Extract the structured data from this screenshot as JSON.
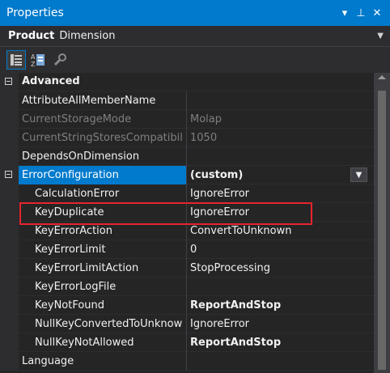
{
  "window": {
    "title": "Properties",
    "buttons": [
      "▾",
      "⊥",
      "✕"
    ]
  },
  "object": {
    "name": "Product",
    "type": "Dimension"
  },
  "toolbar": {
    "tools": [
      "categorized-icon",
      "alphabetical-icon",
      "property-pages-icon"
    ]
  },
  "grid": {
    "category": "Advanced",
    "rows": [
      {
        "name": "AttributeAllMemberName",
        "value": "",
        "style": "normal"
      },
      {
        "name": "CurrentStorageMode",
        "value": "Molap",
        "style": "gray"
      },
      {
        "name": "CurrentStringStoresCompatibil",
        "value": "1050",
        "style": "gray"
      },
      {
        "name": "DependsOnDimension",
        "value": "",
        "style": "normal"
      },
      {
        "name": "ErrorConfiguration",
        "value": "(custom)",
        "style": "selected-expandable"
      },
      {
        "name": "CalculationError",
        "value": "IgnoreError",
        "style": "child"
      },
      {
        "name": "KeyDuplicate",
        "value": "IgnoreError",
        "style": "child"
      },
      {
        "name": "KeyErrorAction",
        "value": "ConvertToUnknown",
        "style": "child"
      },
      {
        "name": "KeyErrorLimit",
        "value": "0",
        "style": "child"
      },
      {
        "name": "KeyErrorLimitAction",
        "value": "StopProcessing",
        "style": "child"
      },
      {
        "name": "KeyErrorLogFile",
        "value": "",
        "style": "child"
      },
      {
        "name": "KeyNotFound",
        "value": "ReportAndStop",
        "style": "child-bold"
      },
      {
        "name": "NullKeyConvertedToUnknow",
        "value": "IgnoreError",
        "style": "child"
      },
      {
        "name": "NullKeyNotAllowed",
        "value": "ReportAndStop",
        "style": "child-bold"
      },
      {
        "name": "Language",
        "value": "",
        "style": "normal"
      }
    ]
  },
  "colors": {
    "accent": "#007acc",
    "highlight_box": "#e8242c"
  }
}
